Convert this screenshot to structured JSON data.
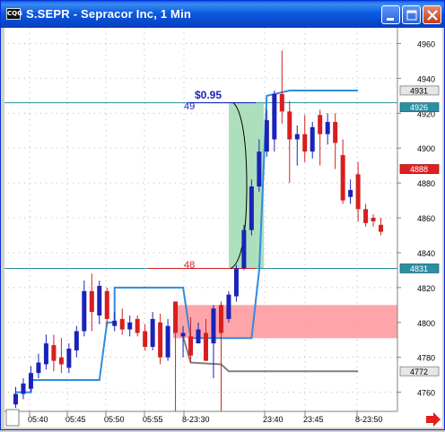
{
  "window": {
    "icon_text": "CQG",
    "title": "S.SEPR - Sepracor Inc, 1 Min",
    "controls": [
      "minimize",
      "maximize",
      "close"
    ]
  },
  "annotations": {
    "gain_label": "$0.95",
    "upper_level": "49",
    "lower_level": "48"
  },
  "price_markers": [
    {
      "label": "4931",
      "style": "gray"
    },
    {
      "label": "4926",
      "style": "teal"
    },
    {
      "label": "4888",
      "style": "red"
    },
    {
      "label": "4831",
      "style": "teal"
    },
    {
      "label": "4772",
      "style": "gray"
    }
  ],
  "colors": {
    "up_candle": "#1a23b8",
    "down_candle": "#d81e1e",
    "blue_line": "#2f8ce0",
    "teal_line": "#2b8fa3",
    "red_zone": "#ff9aa0",
    "green_zone": "#a5dcb6"
  },
  "chart_data": {
    "type": "candlestick",
    "y_ticks": [
      4760,
      4780,
      4800,
      4820,
      4840,
      4860,
      4880,
      4900,
      4920,
      4940,
      4960
    ],
    "ylim": [
      4749,
      4969
    ],
    "x_ticks": [
      "05:40",
      "05:45",
      "05:50",
      "05:55",
      "8-23:30",
      "23:40",
      "23:45",
      "8-23:50"
    ],
    "horizontal_levels": [
      4926,
      4831
    ],
    "gap_fill_zone": {
      "low": 4791,
      "high": 4810
    },
    "move_zone": {
      "low": 4831,
      "high": 4926
    },
    "blue_line": [
      [
        0,
        4760
      ],
      [
        1,
        4760
      ],
      [
        2,
        4760
      ],
      [
        2,
        4767
      ],
      [
        11,
        4767
      ],
      [
        12,
        4800
      ],
      [
        13,
        4800
      ],
      [
        13,
        4820
      ],
      [
        22,
        4820
      ],
      [
        23,
        4791
      ],
      [
        31,
        4791
      ],
      [
        32,
        4830
      ],
      [
        33,
        4930
      ],
      [
        36,
        4933
      ],
      [
        45,
        4933
      ]
    ],
    "gray_line": [
      [
        22,
        4792
      ],
      [
        23,
        4777
      ],
      [
        27,
        4776
      ],
      [
        28,
        4772
      ],
      [
        45,
        4772
      ]
    ],
    "candles": [
      {
        "i": 0,
        "o": 4753,
        "h": 4763,
        "l": 4751,
        "c": 4759,
        "up": true
      },
      {
        "i": 1,
        "o": 4759,
        "h": 4768,
        "l": 4756,
        "c": 4765,
        "up": true
      },
      {
        "i": 2,
        "o": 4762,
        "h": 4775,
        "l": 4760,
        "c": 4771,
        "up": true
      },
      {
        "i": 3,
        "o": 4771,
        "h": 4782,
        "l": 4768,
        "c": 4777,
        "up": true
      },
      {
        "i": 4,
        "o": 4776,
        "h": 4793,
        "l": 4773,
        "c": 4788,
        "up": true
      },
      {
        "i": 5,
        "o": 4787,
        "h": 4793,
        "l": 4772,
        "c": 4778,
        "up": false
      },
      {
        "i": 6,
        "o": 4780,
        "h": 4791,
        "l": 4771,
        "c": 4776,
        "up": false
      },
      {
        "i": 7,
        "o": 4774,
        "h": 4788,
        "l": 4771,
        "c": 4785,
        "up": true
      },
      {
        "i": 8,
        "o": 4784,
        "h": 4798,
        "l": 4780,
        "c": 4795,
        "up": true
      },
      {
        "i": 9,
        "o": 4795,
        "h": 4824,
        "l": 4792,
        "c": 4818,
        "up": true
      },
      {
        "i": 10,
        "o": 4818,
        "h": 4828,
        "l": 4795,
        "c": 4806,
        "up": false
      },
      {
        "i": 11,
        "o": 4804,
        "h": 4824,
        "l": 4799,
        "c": 4821,
        "up": true
      },
      {
        "i": 12,
        "o": 4818,
        "h": 4820,
        "l": 4798,
        "c": 4802,
        "up": false
      },
      {
        "i": 13,
        "o": 4798,
        "h": 4806,
        "l": 4795,
        "c": 4801,
        "up": true
      },
      {
        "i": 14,
        "o": 4802,
        "h": 4808,
        "l": 4793,
        "c": 4796,
        "up": false
      },
      {
        "i": 15,
        "o": 4796,
        "h": 4804,
        "l": 4792,
        "c": 4800,
        "up": true
      },
      {
        "i": 16,
        "o": 4802,
        "h": 4804,
        "l": 4792,
        "c": 4794,
        "up": false
      },
      {
        "i": 17,
        "o": 4795,
        "h": 4799,
        "l": 4784,
        "c": 4786,
        "up": false
      },
      {
        "i": 18,
        "o": 4786,
        "h": 4806,
        "l": 4784,
        "c": 4802,
        "up": true
      },
      {
        "i": 19,
        "o": 4800,
        "h": 4805,
        "l": 4776,
        "c": 4780,
        "up": false
      },
      {
        "i": 20,
        "o": 4780,
        "h": 4802,
        "l": 4778,
        "c": 4798,
        "up": true
      },
      {
        "i": 21,
        "o": 4812,
        "h": 4812,
        "l": 4742,
        "c": 4794,
        "up": false
      },
      {
        "i": 22,
        "o": 4792,
        "h": 4798,
        "l": 4780,
        "c": 4794,
        "up": true
      },
      {
        "i": 23,
        "o": 4792,
        "h": 4803,
        "l": 4777,
        "c": 4781,
        "up": false
      },
      {
        "i": 24,
        "o": 4788,
        "h": 4800,
        "l": 4788,
        "c": 4796,
        "up": true
      },
      {
        "i": 25,
        "o": 4794,
        "h": 4802,
        "l": 4778,
        "c": 4778,
        "up": false
      },
      {
        "i": 26,
        "o": 4788,
        "h": 4810,
        "l": 4768,
        "c": 4808,
        "up": true
      },
      {
        "i": 27,
        "o": 4810,
        "h": 4812,
        "l": 4736,
        "c": 4794,
        "up": false
      },
      {
        "i": 28,
        "o": 4802,
        "h": 4818,
        "l": 4800,
        "c": 4816,
        "up": true
      },
      {
        "i": 29,
        "o": 4815,
        "h": 4833,
        "l": 4812,
        "c": 4831,
        "up": true
      },
      {
        "i": 30,
        "o": 4831,
        "h": 4856,
        "l": 4830,
        "c": 4853,
        "up": true
      },
      {
        "i": 31,
        "o": 4853,
        "h": 4882,
        "l": 4850,
        "c": 4878,
        "up": true
      },
      {
        "i": 32,
        "o": 4878,
        "h": 4905,
        "l": 4875,
        "c": 4898,
        "up": true
      },
      {
        "i": 33,
        "o": 4898,
        "h": 4922,
        "l": 4895,
        "c": 4916,
        "up": true
      },
      {
        "i": 34,
        "o": 4905,
        "h": 4933,
        "l": 4898,
        "c": 4931,
        "up": true
      },
      {
        "i": 35,
        "o": 4931,
        "h": 4956,
        "l": 4914,
        "c": 4921,
        "up": false
      },
      {
        "i": 36,
        "o": 4921,
        "h": 4927,
        "l": 4880,
        "c": 4905,
        "up": false
      },
      {
        "i": 37,
        "o": 4905,
        "h": 4913,
        "l": 4890,
        "c": 4908,
        "up": true
      },
      {
        "i": 38,
        "o": 4908,
        "h": 4919,
        "l": 4892,
        "c": 4898,
        "up": false
      },
      {
        "i": 39,
        "o": 4898,
        "h": 4915,
        "l": 4894,
        "c": 4912,
        "up": true
      },
      {
        "i": 40,
        "o": 4919,
        "h": 4922,
        "l": 4890,
        "c": 4908,
        "up": false
      },
      {
        "i": 41,
        "o": 4908,
        "h": 4920,
        "l": 4902,
        "c": 4915,
        "up": true
      },
      {
        "i": 42,
        "o": 4915,
        "h": 4920,
        "l": 4888,
        "c": 4903,
        "up": false
      },
      {
        "i": 43,
        "o": 4896,
        "h": 4905,
        "l": 4868,
        "c": 4870,
        "up": false
      },
      {
        "i": 44,
        "o": 4872,
        "h": 4882,
        "l": 4868,
        "c": 4876,
        "up": true
      },
      {
        "i": 45,
        "o": 4885,
        "h": 4892,
        "l": 4858,
        "c": 4865,
        "up": false
      },
      {
        "i": 46,
        "o": 4865,
        "h": 4868,
        "l": 4855,
        "c": 4857,
        "up": false
      },
      {
        "i": 47,
        "o": 4860,
        "h": 4862,
        "l": 4855,
        "c": 4858,
        "up": false
      },
      {
        "i": 48,
        "o": 4856,
        "h": 4860,
        "l": 4850,
        "c": 4852,
        "up": false
      }
    ]
  }
}
